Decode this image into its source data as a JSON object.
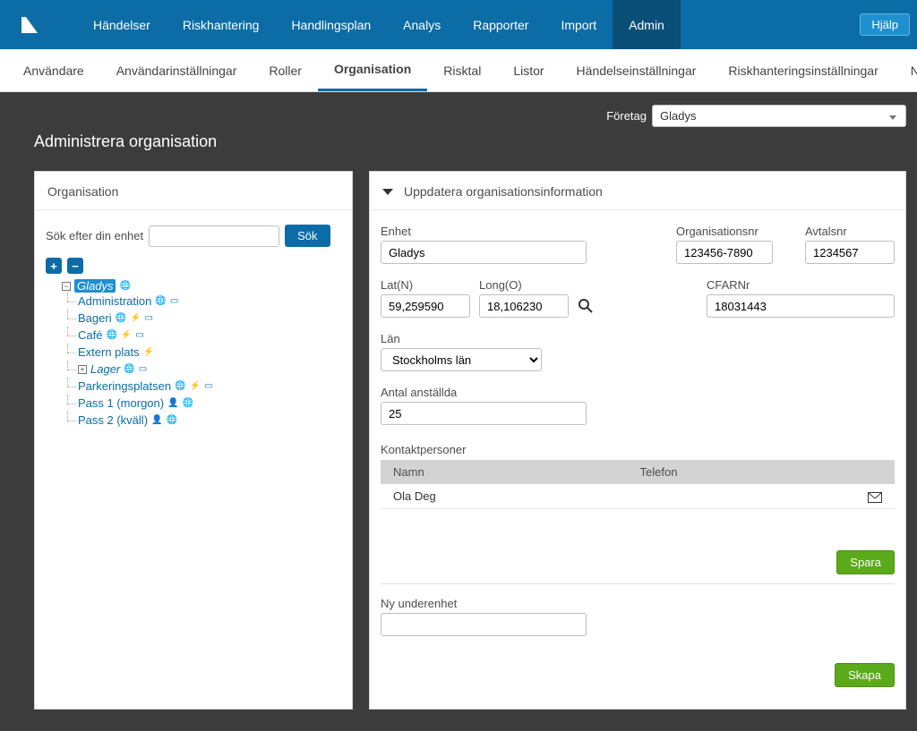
{
  "topnav": {
    "items": [
      "Händelser",
      "Riskhantering",
      "Handlingsplan",
      "Analys",
      "Rapporter",
      "Import",
      "Admin"
    ],
    "active": 6,
    "help": "Hjälp"
  },
  "subnav": {
    "items": [
      "Användare",
      "Användarinställningar",
      "Roller",
      "Organisation",
      "Risktal",
      "Listor",
      "Händelseinställningar",
      "Riskhanteringsinställningar",
      "Nyheter"
    ],
    "active": 3
  },
  "company": {
    "label": "Företag",
    "value": "Gladys"
  },
  "page_title": "Administrera organisation",
  "left": {
    "heading": "Organisation",
    "search_label": "Sök efter din enhet",
    "search_btn": "Sök",
    "tree": {
      "root": "Gladys",
      "children": [
        {
          "label": "Administration",
          "icons": [
            "globe",
            "card"
          ]
        },
        {
          "label": "Bageri",
          "icons": [
            "globe",
            "bolt",
            "card"
          ]
        },
        {
          "label": "Café",
          "icons": [
            "globe",
            "bolt",
            "card"
          ]
        },
        {
          "label": "Extern plats",
          "icons": [
            "bolt"
          ],
          "gray": true
        },
        {
          "label": "Lager",
          "italic": true,
          "icons": [
            "globe",
            "card"
          ],
          "expandable": true
        },
        {
          "label": "Parkeringsplatsen",
          "icons": [
            "globe",
            "bolt",
            "card"
          ]
        },
        {
          "label": "Pass 1 (morgon)",
          "icons": [
            "user",
            "globe"
          ]
        },
        {
          "label": "Pass 2 (kväll)",
          "icons": [
            "user",
            "globe"
          ]
        }
      ]
    }
  },
  "right": {
    "heading": "Uppdatera organisationsinformation",
    "fields": {
      "enhet_label": "Enhet",
      "enhet": "Gladys",
      "orgnr_label": "Organisationsnr",
      "orgnr": "123456-7890",
      "avtal_label": "Avtalsnr",
      "avtal": "1234567",
      "lat_label": "Lat(N)",
      "lat": "59,259590",
      "long_label": "Long(O)",
      "long": "18,106230",
      "cfar_label": "CFARNr",
      "cfar": "18031443",
      "lan_label": "Län",
      "lan": "Stockholms län",
      "antal_label": "Antal anställda",
      "antal": "25"
    },
    "contacts": {
      "title": "Kontaktpersoner",
      "col_name": "Namn",
      "col_phone": "Telefon",
      "rows": [
        {
          "name": "Ola Deg",
          "phone": ""
        }
      ]
    },
    "spara": "Spara",
    "subunit_label": "Ny underenhet",
    "skapa": "Skapa"
  }
}
